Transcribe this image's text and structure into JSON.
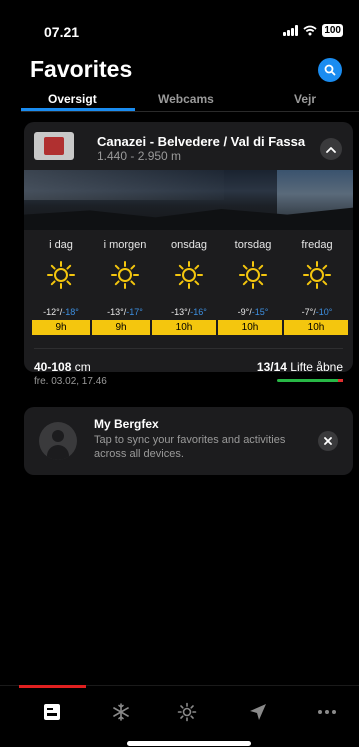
{
  "status_bar": {
    "time": "07.21",
    "battery": "100"
  },
  "header": {
    "title": "Favorites"
  },
  "tabs": [
    {
      "label": "Oversigt",
      "active": true
    },
    {
      "label": "Webcams",
      "active": false
    },
    {
      "label": "Vejr",
      "active": false
    }
  ],
  "resort": {
    "name": "Canazei - Belvedere / Val di Fassa",
    "altitude": "1.440 - 2.950 m",
    "forecast": [
      {
        "day": "i dag",
        "icon": "sun-icon",
        "high": "-12°",
        "low": "-18°",
        "sun_hours": "9h"
      },
      {
        "day": "i morgen",
        "icon": "sun-icon",
        "high": "-13°",
        "low": "-17°",
        "sun_hours": "9h"
      },
      {
        "day": "onsdag",
        "icon": "sun-icon",
        "high": "-13°",
        "low": "-16°",
        "sun_hours": "10h"
      },
      {
        "day": "torsdag",
        "icon": "sun-icon",
        "high": "-9°",
        "low": "-15°",
        "sun_hours": "10h"
      },
      {
        "day": "fredag",
        "icon": "sun-icon",
        "high": "-7°",
        "low": "-10°",
        "sun_hours": "10h"
      }
    ],
    "snow_depth": "40-108",
    "snow_unit": "cm",
    "snow_date": "fre. 03.02, 17.46",
    "lifts_open": "13/14",
    "lifts_label": "Lifte åbne"
  },
  "bergfex": {
    "title": "My Bergfex",
    "description": "Tap to sync your favorites and activities across all devices."
  },
  "bottom_nav": [
    {
      "icon": "favorites-icon",
      "active": true
    },
    {
      "icon": "snowflake-icon",
      "active": false
    },
    {
      "icon": "sun-icon",
      "active": false
    },
    {
      "icon": "navigation-arrow-icon",
      "active": false
    },
    {
      "icon": "more-icon",
      "active": false
    }
  ],
  "colors": {
    "accent": "#1a8cf0",
    "sun_bar": "#f4c60e",
    "low_temp": "#3d8fe0",
    "lift_bar": "#28b846",
    "active_nav": "#e02020"
  }
}
